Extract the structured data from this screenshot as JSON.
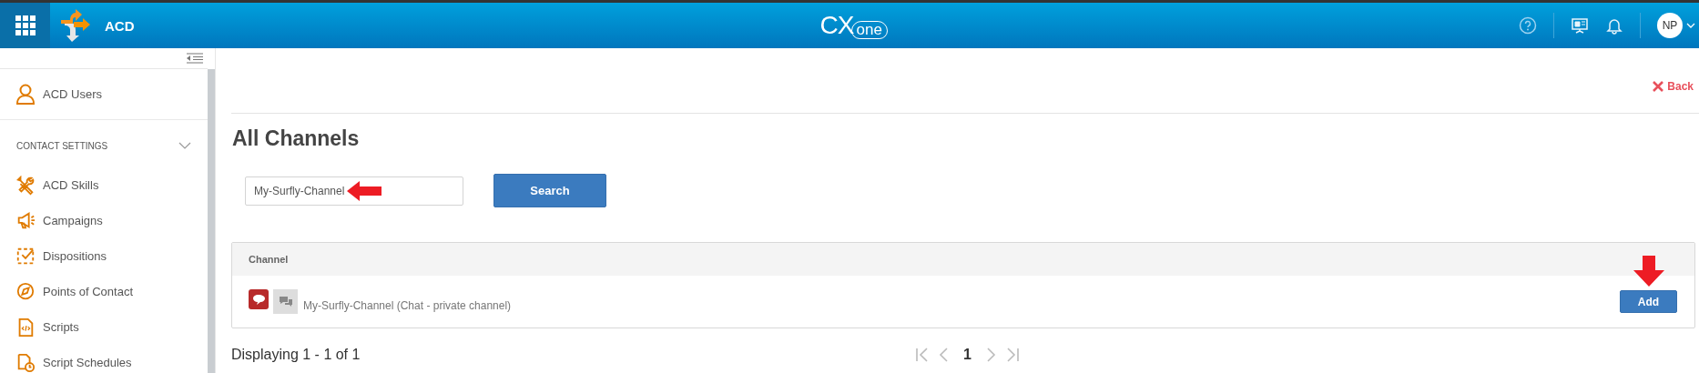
{
  "header": {
    "app_name": "ACD",
    "logo": [
      "CX",
      "one"
    ],
    "avatar": "NP"
  },
  "sidebar": {
    "top_items": [
      {
        "label": "ACD Users"
      }
    ],
    "section": {
      "title": "CONTACT SETTINGS",
      "expanded": true,
      "items": [
        {
          "label": "ACD Skills"
        },
        {
          "label": "Campaigns"
        },
        {
          "label": "Dispositions"
        },
        {
          "label": "Points of Contact"
        },
        {
          "label": "Scripts"
        },
        {
          "label": "Script Schedules"
        }
      ]
    }
  },
  "back": "Back",
  "title": "All Channels",
  "search": {
    "value": "My-Surfly-Channel",
    "button": "Search"
  },
  "table": {
    "columns": [
      "Channel"
    ],
    "rows": [
      {
        "channel": "My-Surfly-Channel (Chat - private channel)",
        "action": "Add"
      }
    ]
  },
  "footer": {
    "displaying": "Displaying 1 - 1 of 1",
    "pages": [
      {
        "label": "1",
        "selected": true
      }
    ]
  }
}
